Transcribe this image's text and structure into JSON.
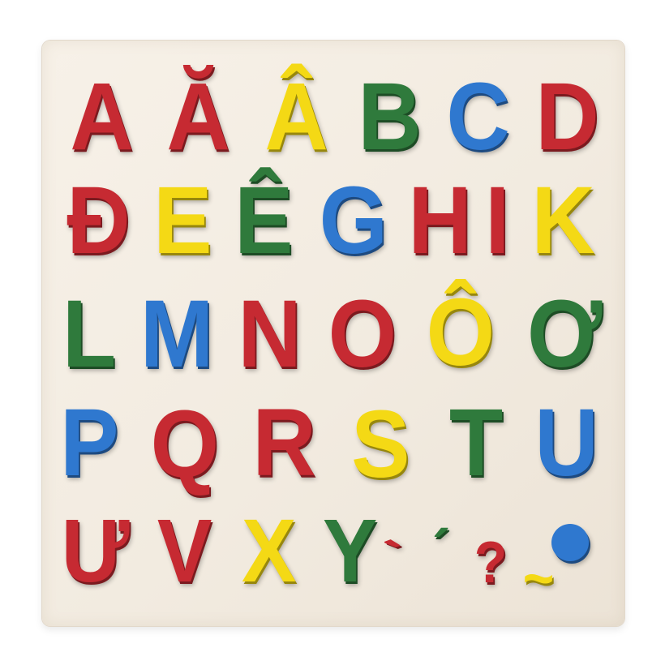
{
  "palette": {
    "red": "#c62a32",
    "yellow": "#f4d915",
    "green": "#2f7a3c",
    "blue": "#2f78cf"
  },
  "board": {
    "rows": [
      [
        {
          "char": "A",
          "color": "red"
        },
        {
          "char": "Ă",
          "color": "red"
        },
        {
          "char": "Â",
          "color": "yellow"
        },
        {
          "char": "B",
          "color": "green"
        },
        {
          "char": "C",
          "color": "blue"
        },
        {
          "char": "D",
          "color": "red"
        }
      ],
      [
        {
          "char": "Đ",
          "color": "red"
        },
        {
          "char": "E",
          "color": "yellow"
        },
        {
          "char": "Ê",
          "color": "green"
        },
        {
          "char": "G",
          "color": "blue"
        },
        {
          "char": "H",
          "color": "red"
        },
        {
          "char": "I",
          "color": "red"
        },
        {
          "char": "K",
          "color": "yellow"
        }
      ],
      [
        {
          "char": "L",
          "color": "green"
        },
        {
          "char": "M",
          "color": "blue"
        },
        {
          "char": "N",
          "color": "red"
        },
        {
          "char": "O",
          "color": "red"
        },
        {
          "char": "Ô",
          "color": "yellow"
        },
        {
          "char": "Ơ",
          "color": "green"
        }
      ],
      [
        {
          "char": "P",
          "color": "blue"
        },
        {
          "char": "Q",
          "color": "red"
        },
        {
          "char": "R",
          "color": "red"
        },
        {
          "char": "S",
          "color": "yellow"
        },
        {
          "char": "T",
          "color": "green"
        },
        {
          "char": "U",
          "color": "blue"
        }
      ],
      [
        {
          "char": "Ư",
          "color": "red"
        },
        {
          "char": "V",
          "color": "red"
        },
        {
          "char": "X",
          "color": "yellow"
        },
        {
          "char": "Y",
          "color": "green"
        }
      ]
    ],
    "tone_marks": [
      {
        "char": "`",
        "color": "red"
      },
      {
        "char": "´",
        "color": "green"
      },
      {
        "char": "?",
        "color": "red"
      },
      {
        "char": "~",
        "color": "yellow"
      },
      {
        "char": "•",
        "color": "blue"
      }
    ]
  }
}
